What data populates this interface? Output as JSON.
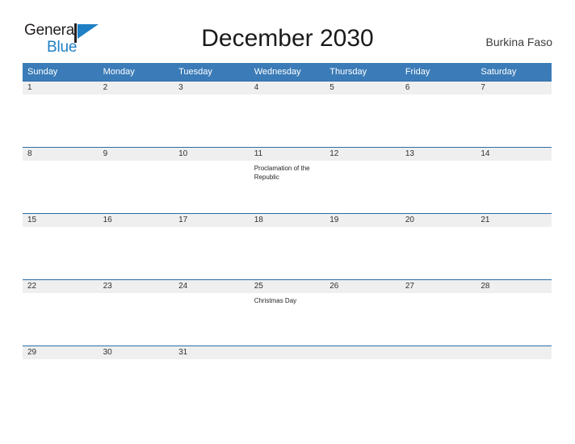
{
  "logo": {
    "word1": "General",
    "word2": "Blue",
    "flag_icon": "blue-triangle-flag-icon",
    "color_primary": "#231f20",
    "color_accent": "#1f7fc4"
  },
  "header": {
    "title": "December 2030",
    "country": "Burkina Faso"
  },
  "theme": {
    "header_blue": "#3b7cb8",
    "rule_blue": "#2e6ca4",
    "band_gray": "#efefef"
  },
  "calendar": {
    "weekdays": [
      "Sunday",
      "Monday",
      "Tuesday",
      "Wednesday",
      "Thursday",
      "Friday",
      "Saturday"
    ],
    "weeks": [
      [
        {
          "day": "1",
          "event": ""
        },
        {
          "day": "2",
          "event": ""
        },
        {
          "day": "3",
          "event": ""
        },
        {
          "day": "4",
          "event": ""
        },
        {
          "day": "5",
          "event": ""
        },
        {
          "day": "6",
          "event": ""
        },
        {
          "day": "7",
          "event": ""
        }
      ],
      [
        {
          "day": "8",
          "event": ""
        },
        {
          "day": "9",
          "event": ""
        },
        {
          "day": "10",
          "event": ""
        },
        {
          "day": "11",
          "event": "Proclamation of the Republic"
        },
        {
          "day": "12",
          "event": ""
        },
        {
          "day": "13",
          "event": ""
        },
        {
          "day": "14",
          "event": ""
        }
      ],
      [
        {
          "day": "15",
          "event": ""
        },
        {
          "day": "16",
          "event": ""
        },
        {
          "day": "17",
          "event": ""
        },
        {
          "day": "18",
          "event": ""
        },
        {
          "day": "19",
          "event": ""
        },
        {
          "day": "20",
          "event": ""
        },
        {
          "day": "21",
          "event": ""
        }
      ],
      [
        {
          "day": "22",
          "event": ""
        },
        {
          "day": "23",
          "event": ""
        },
        {
          "day": "24",
          "event": ""
        },
        {
          "day": "25",
          "event": "Christmas Day"
        },
        {
          "day": "26",
          "event": ""
        },
        {
          "day": "27",
          "event": ""
        },
        {
          "day": "28",
          "event": ""
        }
      ],
      [
        {
          "day": "29",
          "event": ""
        },
        {
          "day": "30",
          "event": ""
        },
        {
          "day": "31",
          "event": ""
        },
        {
          "day": "",
          "event": ""
        },
        {
          "day": "",
          "event": ""
        },
        {
          "day": "",
          "event": ""
        },
        {
          "day": "",
          "event": ""
        }
      ]
    ]
  }
}
